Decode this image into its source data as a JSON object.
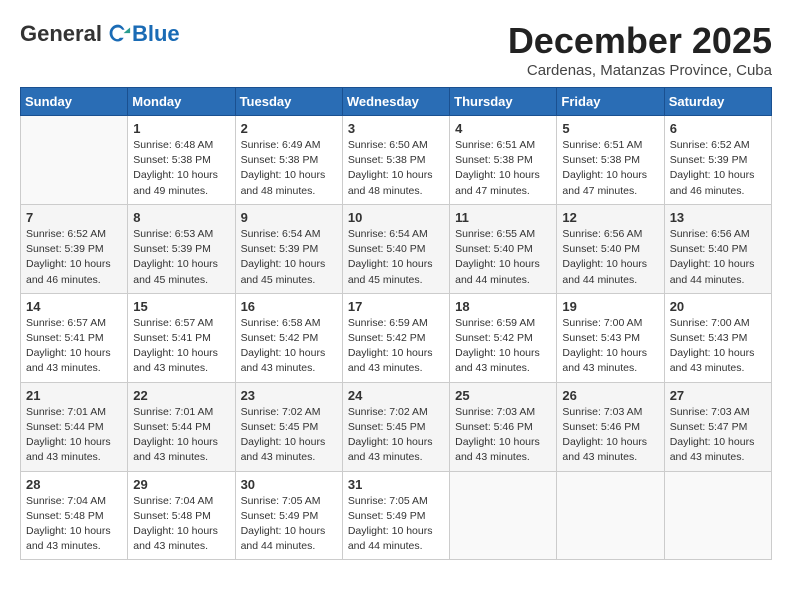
{
  "logo": {
    "general": "General",
    "blue": "Blue"
  },
  "title": "December 2025",
  "subtitle": "Cardenas, Matanzas Province, Cuba",
  "header_days": [
    "Sunday",
    "Monday",
    "Tuesday",
    "Wednesday",
    "Thursday",
    "Friday",
    "Saturday"
  ],
  "weeks": [
    [
      {
        "day": "",
        "info": ""
      },
      {
        "day": "1",
        "info": "Sunrise: 6:48 AM\nSunset: 5:38 PM\nDaylight: 10 hours\nand 49 minutes."
      },
      {
        "day": "2",
        "info": "Sunrise: 6:49 AM\nSunset: 5:38 PM\nDaylight: 10 hours\nand 48 minutes."
      },
      {
        "day": "3",
        "info": "Sunrise: 6:50 AM\nSunset: 5:38 PM\nDaylight: 10 hours\nand 48 minutes."
      },
      {
        "day": "4",
        "info": "Sunrise: 6:51 AM\nSunset: 5:38 PM\nDaylight: 10 hours\nand 47 minutes."
      },
      {
        "day": "5",
        "info": "Sunrise: 6:51 AM\nSunset: 5:38 PM\nDaylight: 10 hours\nand 47 minutes."
      },
      {
        "day": "6",
        "info": "Sunrise: 6:52 AM\nSunset: 5:39 PM\nDaylight: 10 hours\nand 46 minutes."
      }
    ],
    [
      {
        "day": "7",
        "info": "Sunrise: 6:52 AM\nSunset: 5:39 PM\nDaylight: 10 hours\nand 46 minutes."
      },
      {
        "day": "8",
        "info": "Sunrise: 6:53 AM\nSunset: 5:39 PM\nDaylight: 10 hours\nand 45 minutes."
      },
      {
        "day": "9",
        "info": "Sunrise: 6:54 AM\nSunset: 5:39 PM\nDaylight: 10 hours\nand 45 minutes."
      },
      {
        "day": "10",
        "info": "Sunrise: 6:54 AM\nSunset: 5:40 PM\nDaylight: 10 hours\nand 45 minutes."
      },
      {
        "day": "11",
        "info": "Sunrise: 6:55 AM\nSunset: 5:40 PM\nDaylight: 10 hours\nand 44 minutes."
      },
      {
        "day": "12",
        "info": "Sunrise: 6:56 AM\nSunset: 5:40 PM\nDaylight: 10 hours\nand 44 minutes."
      },
      {
        "day": "13",
        "info": "Sunrise: 6:56 AM\nSunset: 5:40 PM\nDaylight: 10 hours\nand 44 minutes."
      }
    ],
    [
      {
        "day": "14",
        "info": "Sunrise: 6:57 AM\nSunset: 5:41 PM\nDaylight: 10 hours\nand 43 minutes."
      },
      {
        "day": "15",
        "info": "Sunrise: 6:57 AM\nSunset: 5:41 PM\nDaylight: 10 hours\nand 43 minutes."
      },
      {
        "day": "16",
        "info": "Sunrise: 6:58 AM\nSunset: 5:42 PM\nDaylight: 10 hours\nand 43 minutes."
      },
      {
        "day": "17",
        "info": "Sunrise: 6:59 AM\nSunset: 5:42 PM\nDaylight: 10 hours\nand 43 minutes."
      },
      {
        "day": "18",
        "info": "Sunrise: 6:59 AM\nSunset: 5:42 PM\nDaylight: 10 hours\nand 43 minutes."
      },
      {
        "day": "19",
        "info": "Sunrise: 7:00 AM\nSunset: 5:43 PM\nDaylight: 10 hours\nand 43 minutes."
      },
      {
        "day": "20",
        "info": "Sunrise: 7:00 AM\nSunset: 5:43 PM\nDaylight: 10 hours\nand 43 minutes."
      }
    ],
    [
      {
        "day": "21",
        "info": "Sunrise: 7:01 AM\nSunset: 5:44 PM\nDaylight: 10 hours\nand 43 minutes."
      },
      {
        "day": "22",
        "info": "Sunrise: 7:01 AM\nSunset: 5:44 PM\nDaylight: 10 hours\nand 43 minutes."
      },
      {
        "day": "23",
        "info": "Sunrise: 7:02 AM\nSunset: 5:45 PM\nDaylight: 10 hours\nand 43 minutes."
      },
      {
        "day": "24",
        "info": "Sunrise: 7:02 AM\nSunset: 5:45 PM\nDaylight: 10 hours\nand 43 minutes."
      },
      {
        "day": "25",
        "info": "Sunrise: 7:03 AM\nSunset: 5:46 PM\nDaylight: 10 hours\nand 43 minutes."
      },
      {
        "day": "26",
        "info": "Sunrise: 7:03 AM\nSunset: 5:46 PM\nDaylight: 10 hours\nand 43 minutes."
      },
      {
        "day": "27",
        "info": "Sunrise: 7:03 AM\nSunset: 5:47 PM\nDaylight: 10 hours\nand 43 minutes."
      }
    ],
    [
      {
        "day": "28",
        "info": "Sunrise: 7:04 AM\nSunset: 5:48 PM\nDaylight: 10 hours\nand 43 minutes."
      },
      {
        "day": "29",
        "info": "Sunrise: 7:04 AM\nSunset: 5:48 PM\nDaylight: 10 hours\nand 43 minutes."
      },
      {
        "day": "30",
        "info": "Sunrise: 7:05 AM\nSunset: 5:49 PM\nDaylight: 10 hours\nand 44 minutes."
      },
      {
        "day": "31",
        "info": "Sunrise: 7:05 AM\nSunset: 5:49 PM\nDaylight: 10 hours\nand 44 minutes."
      },
      {
        "day": "",
        "info": ""
      },
      {
        "day": "",
        "info": ""
      },
      {
        "day": "",
        "info": ""
      }
    ]
  ]
}
